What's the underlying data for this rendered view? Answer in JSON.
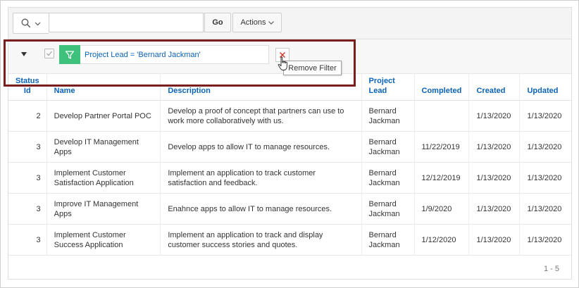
{
  "toolbar": {
    "search_value": "",
    "go_label": "Go",
    "actions_label": "Actions"
  },
  "filter": {
    "text": "Project Lead = 'Bernard Jackman'",
    "enabled": true,
    "tooltip": "Remove Filter",
    "icon": "funnel-icon",
    "accent_color": "#3ec17a",
    "remove_color": "#d0352b"
  },
  "table": {
    "headers": {
      "status": "Status Id",
      "name": "Name",
      "description": "Description",
      "project_lead": "Project Lead",
      "completed": "Completed",
      "created": "Created",
      "updated": "Updated"
    },
    "rows": [
      {
        "status": "2",
        "name": "Develop Partner Portal POC",
        "description": "Develop a proof of concept that partners can use to work more collaboratively with us.",
        "project_lead": "Bernard Jackman",
        "completed": "",
        "created": "1/13/2020",
        "updated": "1/13/2020"
      },
      {
        "status": "3",
        "name": "Develop IT Management Apps",
        "description": "Develop apps to allow IT to manage resources.",
        "project_lead": "Bernard Jackman",
        "completed": "11/22/2019",
        "created": "1/13/2020",
        "updated": "1/13/2020"
      },
      {
        "status": "3",
        "name": "Implement Customer Satisfaction Application",
        "description": "Implement an application to track customer satisfaction and feedback.",
        "project_lead": "Bernard Jackman",
        "completed": "12/12/2019",
        "created": "1/13/2020",
        "updated": "1/13/2020"
      },
      {
        "status": "3",
        "name": "Improve IT Management Apps",
        "description": "Enahnce apps to allow IT to manage resources.",
        "project_lead": "Bernard Jackman",
        "completed": "1/9/2020",
        "created": "1/13/2020",
        "updated": "1/13/2020"
      },
      {
        "status": "3",
        "name": "Implement Customer Success Application",
        "description": "Implement an application to track and display customer success stories and quotes.",
        "project_lead": "Bernard Jackman",
        "completed": "1/12/2020",
        "created": "1/13/2020",
        "updated": "1/13/2020"
      }
    ]
  },
  "pagination": {
    "range": "1 - 5"
  }
}
